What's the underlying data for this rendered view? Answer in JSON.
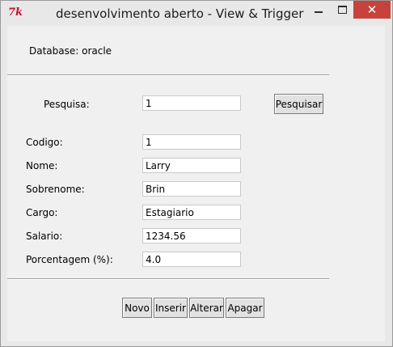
{
  "window": {
    "title": "desenvolvimento aberto - View & Trigger",
    "icon": "tk-feather-icon",
    "controls": {
      "minimize": "minimize-icon",
      "maximize": "maximize-icon",
      "close_glyph": "✕"
    }
  },
  "database_label": "Database: oracle",
  "search": {
    "label": "Pesquisa:",
    "value": "1",
    "button": "Pesquisar"
  },
  "fields": [
    {
      "label": "Codigo:",
      "value": "1"
    },
    {
      "label": "Nome:",
      "value": "Larry"
    },
    {
      "label": "Sobrenome:",
      "value": "Brin"
    },
    {
      "label": "Cargo:",
      "value": "Estagiario"
    },
    {
      "label": "Salario:",
      "value": "1234.56"
    },
    {
      "label": "Porcentagem (%):",
      "value": "4.0"
    }
  ],
  "actions": [
    {
      "label": "Novo"
    },
    {
      "label": "Inserir"
    },
    {
      "label": "Alterar"
    },
    {
      "label": "Apagar"
    }
  ],
  "colors": {
    "close_button": "#c7423a",
    "tk_icon": "#c8102e",
    "background": "#f0f0f0"
  }
}
